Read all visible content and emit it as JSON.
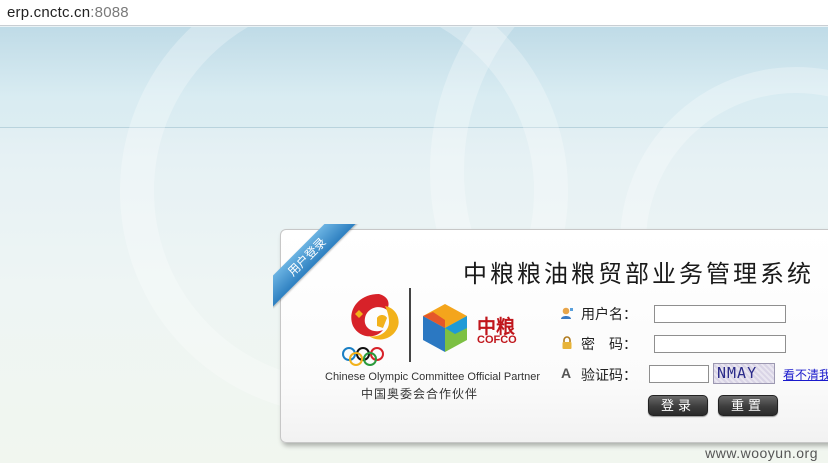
{
  "browser": {
    "url_host": "erp.cnctc.cn",
    "url_port": ":8088"
  },
  "panel": {
    "ribbon": "用户登录",
    "title": "中粮粮油粮贸部业务管理系统"
  },
  "logos": {
    "cofco_cn": "中粮",
    "cofco_en": "COFCO",
    "partner_en": "Chinese Olympic Committee Official Partner",
    "partner_cn": "中国奥委会合作伙伴"
  },
  "form": {
    "username_label": "用户名：",
    "password_label": "密　码：",
    "captcha_label": "验证码：",
    "captcha_icon_glyph": "A",
    "captcha_text": "NMAY",
    "captcha_link": "看不清我",
    "login_button": "登录",
    "reset_button": "重置"
  },
  "watermark": "www.wooyun.org",
  "colors": {
    "brand_red": "#c0161c",
    "ribbon_blue": "#2d7fc0",
    "link_blue": "#1a1acc"
  }
}
